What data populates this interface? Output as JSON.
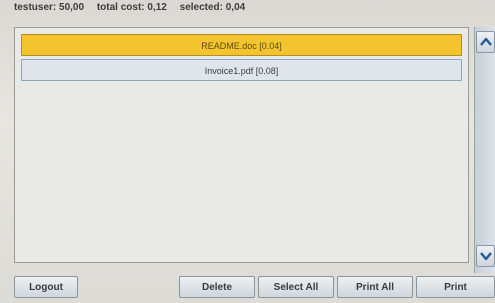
{
  "status": {
    "user": "testuser: 50,00",
    "total_cost": "total cost: 0,12",
    "selected": "selected: 0,04"
  },
  "files": [
    {
      "label": "README.doc [0.04]",
      "selected": true
    },
    {
      "label": "Invoice1.pdf [0.08]",
      "selected": false
    }
  ],
  "buttons": {
    "logout": "Logout",
    "delete": "Delete",
    "select_all": "Select All",
    "print_all": "Print All",
    "print": "Print"
  },
  "icons": {
    "scroll_up": "chevron-up-icon",
    "scroll_down": "chevron-down-icon"
  },
  "colors": {
    "selected_row": "#f4c430",
    "normal_row": "#dfe5ea",
    "arrow": "#1f5a9a"
  }
}
